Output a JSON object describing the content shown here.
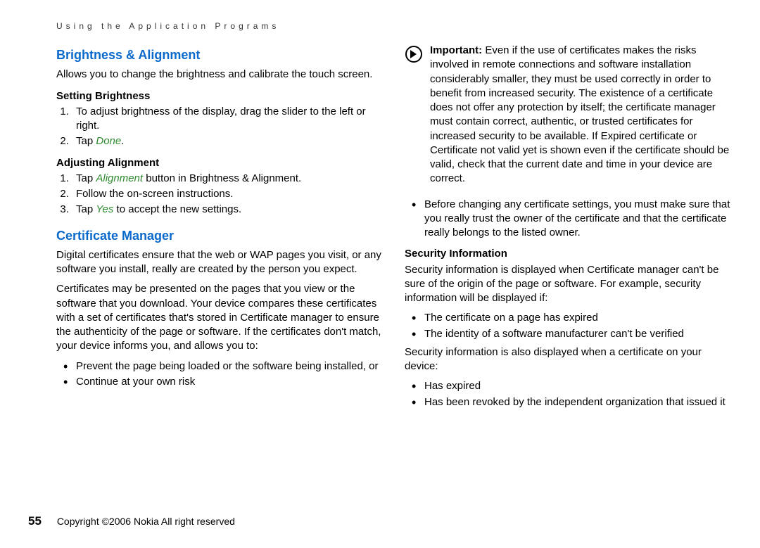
{
  "running_head": "Using the Application Programs",
  "left": {
    "h1": "Brightness & Alignment",
    "intro": "Allows you to change the brightness and calibrate the touch screen.",
    "sub1": "Setting Brightness",
    "ol1_li1": "To adjust brightness of the display, drag the slider to the left or right.",
    "ol1_li2_pre": "Tap ",
    "ol1_li2_em": "Done",
    "ol1_li2_post": ".",
    "sub2": "Adjusting Alignment",
    "ol2_li1_pre": "Tap ",
    "ol2_li1_em": "Alignment",
    "ol2_li1_post": " button in Brightness & Alignment.",
    "ol2_li2": "Follow the on-screen instructions.",
    "ol2_li3_pre": "Tap ",
    "ol2_li3_em": "Yes",
    "ol2_li3_post": " to accept the new settings.",
    "h2": "Certificate Manager",
    "p1": "Digital certificates ensure that the web or WAP pages you visit, or any software you install, really are created by the person you expect.",
    "p2": "Certificates may be presented on the pages that you view or the software that you download. Your device compares these certificates with a set of certificates that's stored in Certificate manager to ensure the authenticity of the page or software. If the certificates don't match, your device informs you, and allows you to:",
    "ul_li1": "Prevent the page being loaded or the software being installed, or",
    "ul_li2": "Continue at your own risk"
  },
  "right": {
    "imp_label": "Important:",
    "imp_text": " Even if the use of certificates makes the risks involved in remote connections and software installation considerably smaller, they must be used correctly in order to benefit from increased security. The existence of a certificate does not offer any protection by itself; the certificate manager must contain correct, authentic, or trusted certificates for increased security to be available. If Expired certificate or Certificate not valid yet is shown even if the certificate should be valid, check that the current date and time in your device are correct.",
    "ul1_li1": "Before changing any certificate settings, you must make sure that you really trust the owner of the certificate and that the certificate really belongs to the listed owner.",
    "sub1": "Security Information",
    "p1": "Security information is displayed when Certificate manager can't be sure of the origin of the page or software. For example, security information will be displayed if:",
    "ul2_li1": "The certificate on a page has expired",
    "ul2_li2": "The identity of a software manufacturer can't be verified",
    "p2": "Security information is also displayed when a certificate on your device:",
    "ul3_li1": "Has expired",
    "ul3_li2": "Has been revoked by the independent organization that issued it"
  },
  "footer": {
    "page": "55",
    "copyright": "Copyright ©2006 Nokia All right reserved"
  }
}
